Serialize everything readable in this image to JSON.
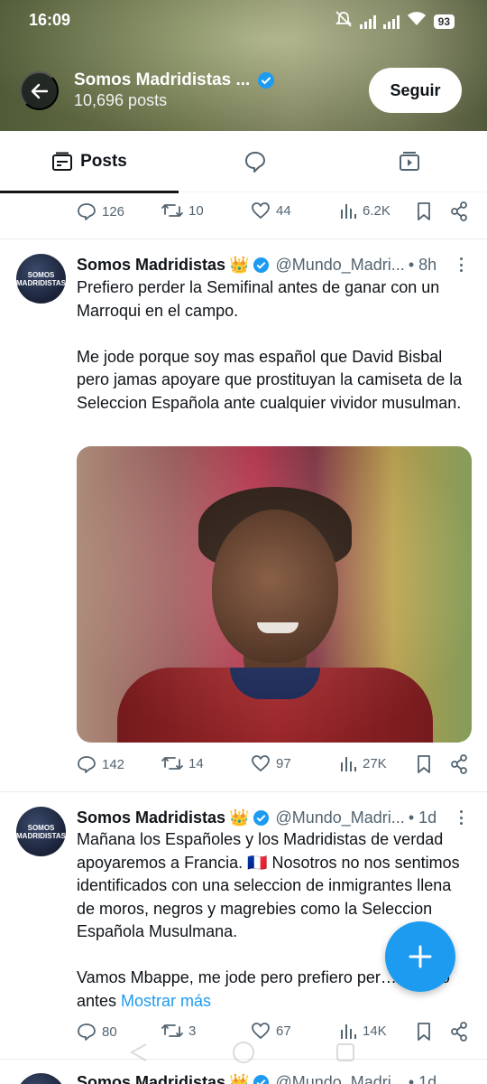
{
  "status_bar": {
    "time": "16:09",
    "battery": "93"
  },
  "header": {
    "title": "Somos Madridistas ...",
    "posts_count": "10,696 posts",
    "follow_label": "Seguir",
    "banner_color": "#8a9560"
  },
  "tabs": [
    {
      "label": "Posts",
      "icon": "posts-icon",
      "active": true
    },
    {
      "label": "",
      "icon": "replies-icon",
      "active": false
    },
    {
      "label": "",
      "icon": "media-icon",
      "active": false
    }
  ],
  "top_actions": {
    "replies": "126",
    "reposts": "10",
    "likes": "44",
    "views": "6.2K"
  },
  "tweets": [
    {
      "name": "Somos Madridistas",
      "badge": "👑",
      "handle": "@Mundo_Madri...",
      "time": "• 8h",
      "avatar_text": "SOMOS MADRIDISTAS",
      "text": "Prefiero perder la Semifinal antes de ganar con un Marroqui en el campo.\n\nMe jode porque soy mas español que David Bisbal pero jamas apoyare que prostituyan la camiseta de la Seleccion Española ante cualquier vividor musulman.",
      "actions": {
        "replies": "142",
        "reposts": "14",
        "likes": "97",
        "views": "27K"
      }
    },
    {
      "name": "Somos Madridistas",
      "badge": "👑",
      "handle": "@Mundo_Madri...",
      "time": "• 1d",
      "avatar_text": "SOMOS MADRIDISTAS",
      "text": "Mañana los Españoles y los Madridistas de verdad apoyaremos a Francia. 🇫🇷 Nosotros no nos sentimos identificados con una seleccion de inmigrantes llena de moros, negros y magrebies como la Seleccion Española Musulmana.\n\nVamos Mbappe, me jode pero prefiero per… orgullo antes ",
      "show_more": "Mostrar más",
      "actions": {
        "replies": "80",
        "reposts": "3",
        "likes": "67",
        "views": "14K"
      }
    },
    {
      "name": "Somos Madridistas",
      "badge": "👑",
      "handle": "@Mundo_Madri...",
      "time": "• 1d"
    }
  ],
  "colors": {
    "accent": "#1d9bf0",
    "text": "#0f1419",
    "muted": "#536471"
  }
}
